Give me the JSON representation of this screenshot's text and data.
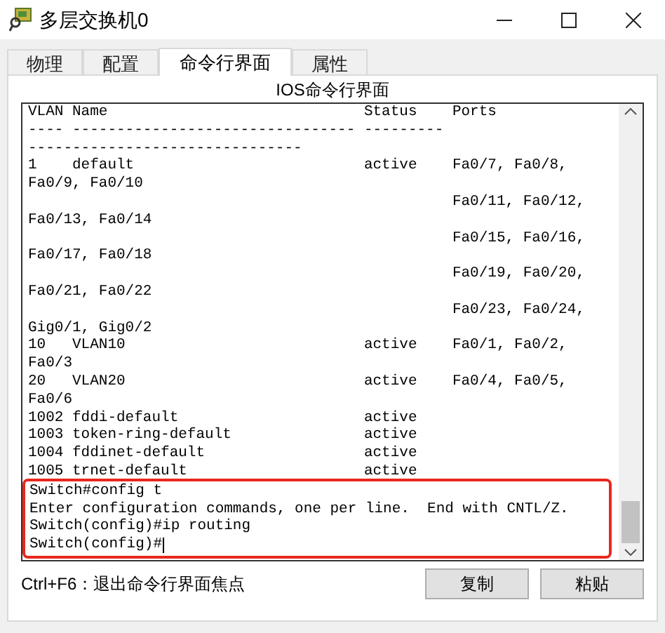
{
  "window": {
    "title": "多层交换机0"
  },
  "tabs": [
    {
      "label": "物理",
      "selected": false
    },
    {
      "label": "配置",
      "selected": false
    },
    {
      "label": "命令行界面",
      "selected": true
    },
    {
      "label": "属性",
      "selected": false
    }
  ],
  "panel_title": "IOS命令行界面",
  "terminal": {
    "lines": [
      "VLAN Name                             Status    Ports",
      "---- -------------------------------- --------- ",
      "-------------------------------",
      "1    default                          active    Fa0/7, Fa0/8,",
      "Fa0/9, Fa0/10",
      "                                                Fa0/11, Fa0/12,",
      "Fa0/13, Fa0/14",
      "                                                Fa0/15, Fa0/16,",
      "Fa0/17, Fa0/18",
      "                                                Fa0/19, Fa0/20,",
      "Fa0/21, Fa0/22",
      "                                                Fa0/23, Fa0/24,",
      "Gig0/1, Gig0/2",
      "10   VLAN10                           active    Fa0/1, Fa0/2,",
      "Fa0/3",
      "20   VLAN20                           active    Fa0/4, Fa0/5,",
      "Fa0/6",
      "1002 fddi-default                     active    ",
      "1003 token-ring-default               active    ",
      "1004 fddinet-default                  active    ",
      "1005 trnet-default                    active    "
    ],
    "highlighted_lines": [
      "Switch#config t",
      "Enter configuration commands, one per line.  End with CNTL/Z.",
      "Switch(config)#ip routing",
      "Switch(config)#"
    ]
  },
  "hint": "Ctrl+F6：退出命令行界面焦点",
  "buttons": [
    "复制",
    "粘贴"
  ]
}
